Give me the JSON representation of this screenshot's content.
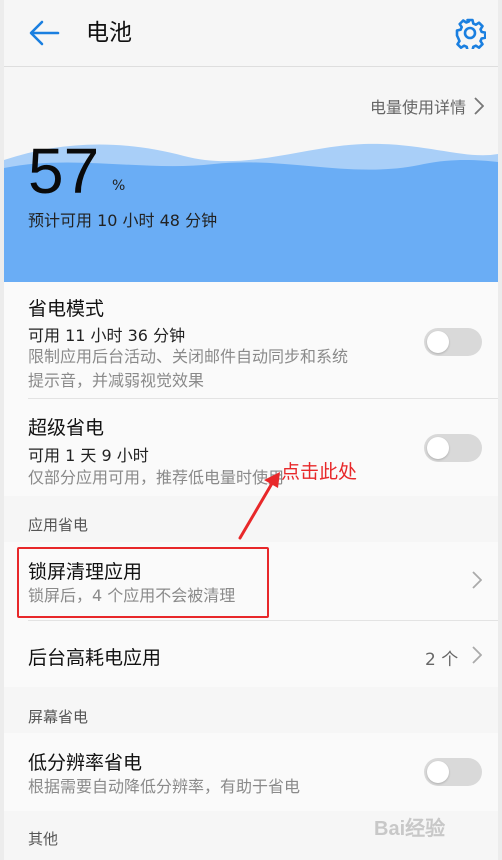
{
  "header": {
    "title": "电池"
  },
  "detail_link": "电量使用详情",
  "battery": {
    "percent": "57",
    "unit": "%",
    "remaining": "预计可用 10 小时 48 分钟",
    "level": 0.57
  },
  "items": {
    "power_saving": {
      "title": "省电模式",
      "sub": "可用 11 小时 36 分钟",
      "desc_line1": "限制应用后台活动、关闭邮件自动同步和系统",
      "desc_line2": "提示音，并减弱视觉效果"
    },
    "ultra_saving": {
      "title": "超级省电",
      "sub": "可用 1 天 9 小时",
      "desc": "仅部分应用可用，推荐低电量时使用"
    },
    "lock_clean": {
      "title": "锁屏清理应用",
      "desc": "锁屏后，4 个应用不会被清理"
    },
    "bg_high": {
      "title": "后台高耗电应用",
      "count": "2 个"
    },
    "low_res": {
      "title": "低分辨率省电",
      "desc": "根据需要自动降低分辨率，有助于省电"
    }
  },
  "sections": {
    "app": "应用省电",
    "screen": "屏幕省电",
    "other": "其他"
  },
  "annotation": {
    "text": "点击此处"
  },
  "watermark": "Bai经验",
  "colors": {
    "accent": "#1a7fe0",
    "wave": "#6aadf5",
    "annotation": "#e8282a"
  },
  "icons": {
    "back": "arrow-left-icon",
    "settings": "gear-icon",
    "chevron": "chevron-right-icon"
  }
}
